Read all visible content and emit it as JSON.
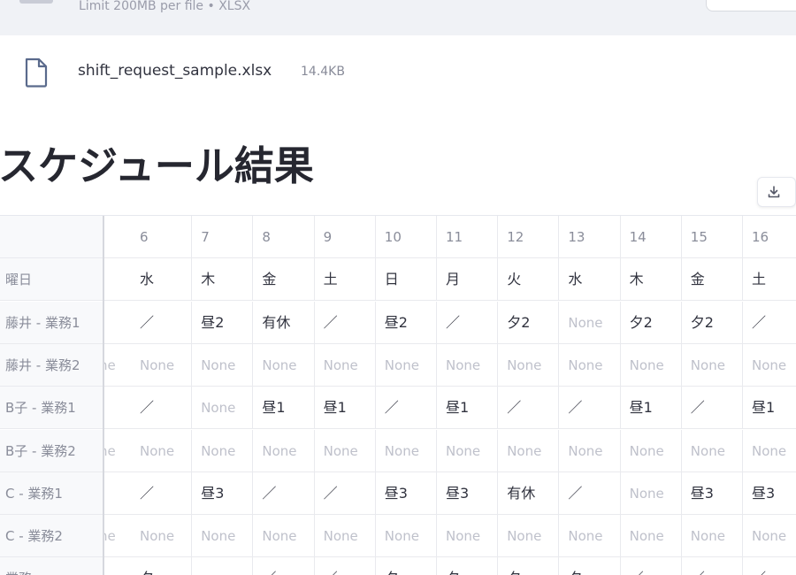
{
  "uploader": {
    "limit_text": "Limit 200MB per file • XLSX"
  },
  "file": {
    "name": "shift_request_sample.xlsx",
    "size": "14.4KB"
  },
  "title": "スケジュール結果",
  "table": {
    "columns": [
      "6",
      "7",
      "8",
      "9",
      "10",
      "11",
      "12",
      "13",
      "14",
      "15",
      "16"
    ],
    "rows": [
      {
        "label": "曜日",
        "peek": "",
        "cells": [
          "水",
          "木",
          "金",
          "土",
          "日",
          "月",
          "火",
          "水",
          "木",
          "金",
          "土"
        ]
      },
      {
        "label": "藤井 - 業務1",
        "peek": "",
        "cells": [
          "／",
          "昼2",
          "有休",
          "／",
          "昼2",
          "／",
          "夕2",
          "None",
          "夕2",
          "夕2",
          "／"
        ]
      },
      {
        "label": "藤井 - 業務2",
        "peek": "ne",
        "cells": [
          "None",
          "None",
          "None",
          "None",
          "None",
          "None",
          "None",
          "None",
          "None",
          "None",
          "None"
        ]
      },
      {
        "label": "B子 - 業務1",
        "peek": "",
        "cells": [
          "／",
          "None",
          "昼1",
          "昼1",
          "／",
          "昼1",
          "／",
          "／",
          "昼1",
          "／",
          "昼1"
        ]
      },
      {
        "label": "B子 - 業務2",
        "peek": "ne",
        "cells": [
          "None",
          "None",
          "None",
          "None",
          "None",
          "None",
          "None",
          "None",
          "None",
          "None",
          "None"
        ]
      },
      {
        "label": "C - 業務1",
        "peek": "",
        "cells": [
          "／",
          "昼3",
          "／",
          "／",
          "昼3",
          "昼3",
          "有休",
          "／",
          "None",
          "昼3",
          "昼3"
        ]
      },
      {
        "label": "C - 業務2",
        "peek": "ne",
        "cells": [
          "None",
          "None",
          "None",
          "None",
          "None",
          "None",
          "None",
          "None",
          "None",
          "None",
          "None"
        ]
      },
      {
        "label": "業務",
        "peek": "",
        "cells": [
          "夕",
          "",
          "／",
          "／",
          "夕",
          "夕",
          "夕",
          "夕",
          "／",
          "／",
          "／"
        ]
      }
    ]
  },
  "icons": {
    "file": "file-icon",
    "download": "download-icon"
  }
}
